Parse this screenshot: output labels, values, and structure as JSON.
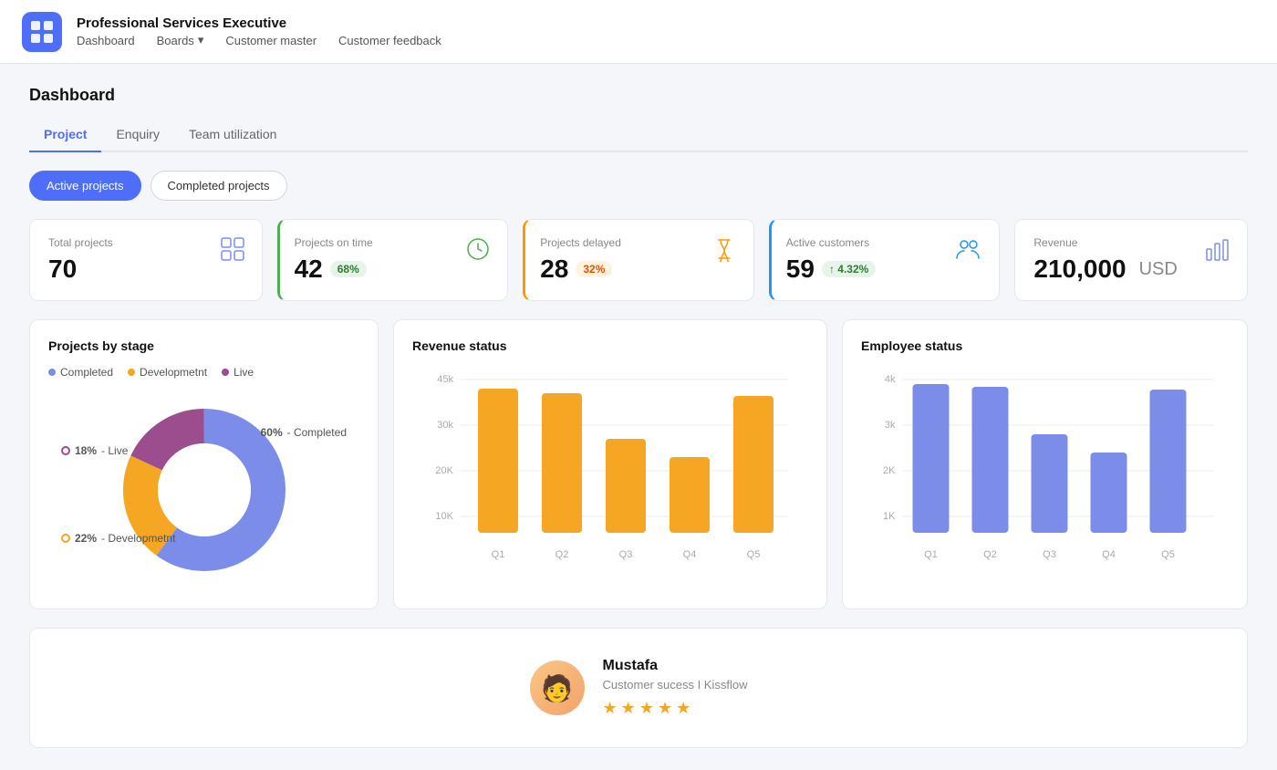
{
  "header": {
    "app_title": "Professional Services Executive",
    "nav_items": [
      "Dashboard",
      "Boards",
      "Customer master",
      "Customer feedback"
    ]
  },
  "dashboard": {
    "title": "Dashboard",
    "tabs": [
      "Project",
      "Enquiry",
      "Team utilization"
    ],
    "active_tab": "Project",
    "buttons": [
      "Active projects",
      "Completed projects"
    ],
    "active_button": "Active projects"
  },
  "kpis": [
    {
      "label": "Total projects",
      "value": "70",
      "badge": null,
      "icon": "grid-icon"
    },
    {
      "label": "Projects on time",
      "value": "42",
      "badge": "68%",
      "badge_type": "green",
      "icon": "clock-icon"
    },
    {
      "label": "Projects delayed",
      "value": "28",
      "badge": "32%",
      "badge_type": "orange",
      "icon": "hourglass-icon"
    },
    {
      "label": "Active customers",
      "value": "59",
      "badge": "↑ 4.32%",
      "badge_type": "green",
      "icon": "users-icon"
    },
    {
      "label": "Revenue",
      "value": "210,000",
      "value_suffix": "USD",
      "badge": null,
      "icon": "bar-chart-icon"
    }
  ],
  "projects_by_stage": {
    "title": "Projects by stage",
    "legend": [
      {
        "label": "Completed",
        "color": "#7b8de8"
      },
      {
        "label": "Developmetnt",
        "color": "#f5a623"
      },
      {
        "label": "Live",
        "color": "#9b4d8e"
      }
    ],
    "segments": [
      {
        "label": "Completed",
        "pct": 60,
        "color": "#7b8de8"
      },
      {
        "label": "Developmetnt",
        "pct": 22,
        "color": "#f5a623"
      },
      {
        "label": "Live",
        "pct": 18,
        "color": "#9b4d8e"
      }
    ]
  },
  "revenue_status": {
    "title": "Revenue status",
    "y_labels": [
      "45k",
      "30k",
      "20K",
      "10K"
    ],
    "bars": [
      {
        "label": "Q1",
        "value": 85
      },
      {
        "label": "Q2",
        "value": 82
      },
      {
        "label": "Q3",
        "value": 55
      },
      {
        "label": "Q4",
        "value": 45
      },
      {
        "label": "Q5",
        "value": 80
      }
    ],
    "color": "#f5a623"
  },
  "employee_status": {
    "title": "Employee status",
    "y_labels": [
      "4k",
      "3k",
      "2K",
      "1K"
    ],
    "bars": [
      {
        "label": "Q1",
        "value": 88
      },
      {
        "label": "Q2",
        "value": 85
      },
      {
        "label": "Q3",
        "value": 62
      },
      {
        "label": "Q4",
        "value": 52
      },
      {
        "label": "Q5",
        "value": 82
      }
    ],
    "color": "#7b8de8"
  },
  "review": {
    "name": "Mustafa",
    "role": "Customer sucess I Kissflow",
    "stars": [
      "★",
      "★",
      "★",
      "★",
      "★"
    ]
  }
}
